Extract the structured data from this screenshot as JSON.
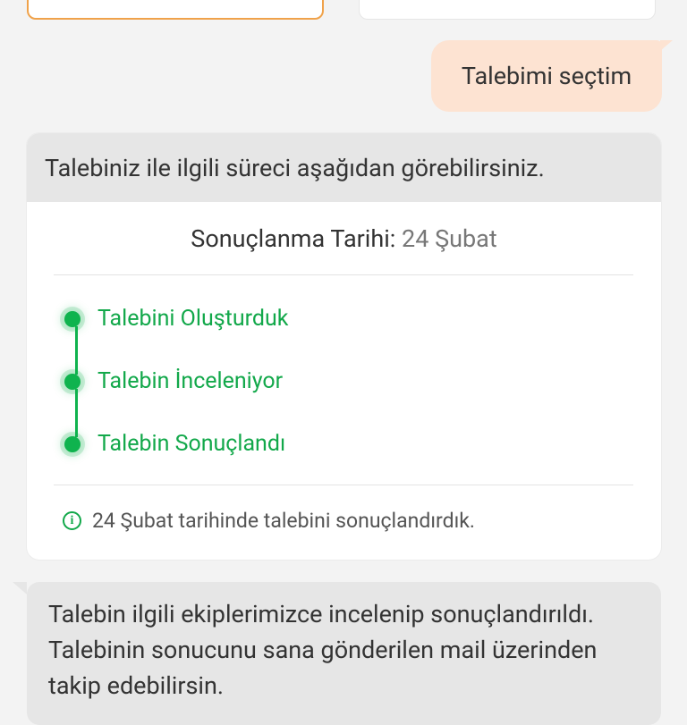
{
  "user_message": {
    "text": "Talebimi seçtim"
  },
  "status_card": {
    "header": "Talebiniz ile ilgili süreci aşağıdan görebilirsiniz.",
    "result_date_label": "Sonuçlanma Tarihi:",
    "result_date_value": "24 Şubat",
    "steps": [
      {
        "label": "Talebini Oluşturduk",
        "completed": true
      },
      {
        "label": "Talebin İnceleniyor",
        "completed": true
      },
      {
        "label": "Talebin Sonuçlandı",
        "completed": true
      }
    ],
    "info_text": "24 Şubat tarihinde talebini sonuçlandırdık."
  },
  "bot_message": {
    "text": "Talebin ilgili ekiplerimizce incelenip sonuçlandırıldı. Talebinin sonucunu sana gönderilen mail üzerinden takip edebilirsin."
  },
  "colors": {
    "accent_green": "#0fb34e",
    "user_bubble": "#fde3d2",
    "selected_border": "#f0a24a",
    "bot_bubble": "#e6e6e6"
  }
}
